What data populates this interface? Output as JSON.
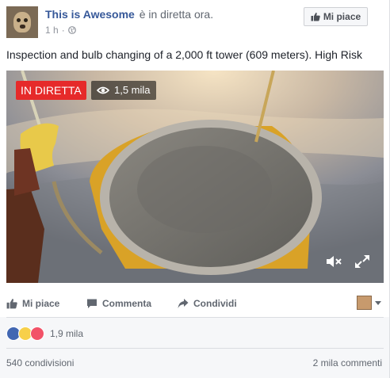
{
  "post": {
    "page_name": "This is Awesome",
    "live_status": "è in diretta ora.",
    "time": "1 h",
    "dot": "·",
    "like_page_label": "Mi piace",
    "text": "Inspection and bulb changing of a 2,000 ft tower (609 meters). High Risk"
  },
  "video": {
    "live_badge": "IN DIRETTA",
    "viewers": "1,5 mila",
    "live_color": "#e62a2a"
  },
  "actions": {
    "like": "Mi piace",
    "comment": "Commenta",
    "share": "Condividi"
  },
  "stats": {
    "reactions_count": "1,9 mila",
    "shares": "540 condivisioni",
    "comments": "2 mila commenti"
  },
  "icons": [
    "thumbs-up-icon",
    "globe-icon",
    "eye-icon",
    "mute-icon",
    "fullscreen-icon",
    "comment-icon",
    "share-icon",
    "chevron-down-icon"
  ],
  "colors": {
    "brand": "#365899",
    "accent": "#4267b2"
  }
}
